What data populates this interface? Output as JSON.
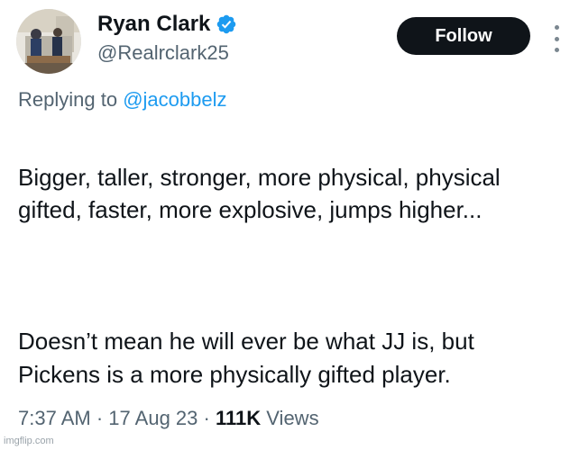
{
  "author": {
    "display_name": "Ryan Clark",
    "handle": "@Realrclark25",
    "verified_icon": "verified-badge-icon",
    "verified_color": "#1d9bf0"
  },
  "actions": {
    "follow_label": "Follow",
    "more_icon": "more-options-icon"
  },
  "reply": {
    "prefix": "Replying to",
    "mention": "@jacobbelz"
  },
  "body": {
    "paragraph_1": "Bigger, taller, stronger, more physical, physical gifted, faster, more explosive, jumps higher...",
    "paragraph_2": "Doesn’t mean he will ever be what JJ is, but Pickens is a more physically gifted player."
  },
  "meta": {
    "time": "7:37 AM",
    "separator_1": "·",
    "date": "17 Aug 23",
    "separator_2": "·",
    "views_count": "111K",
    "views_label": "Views"
  },
  "watermark": "imgflip.com",
  "colors": {
    "text_primary": "#0f1419",
    "text_secondary": "#536471",
    "link": "#1d9bf0",
    "button_bg": "#0f1419"
  }
}
